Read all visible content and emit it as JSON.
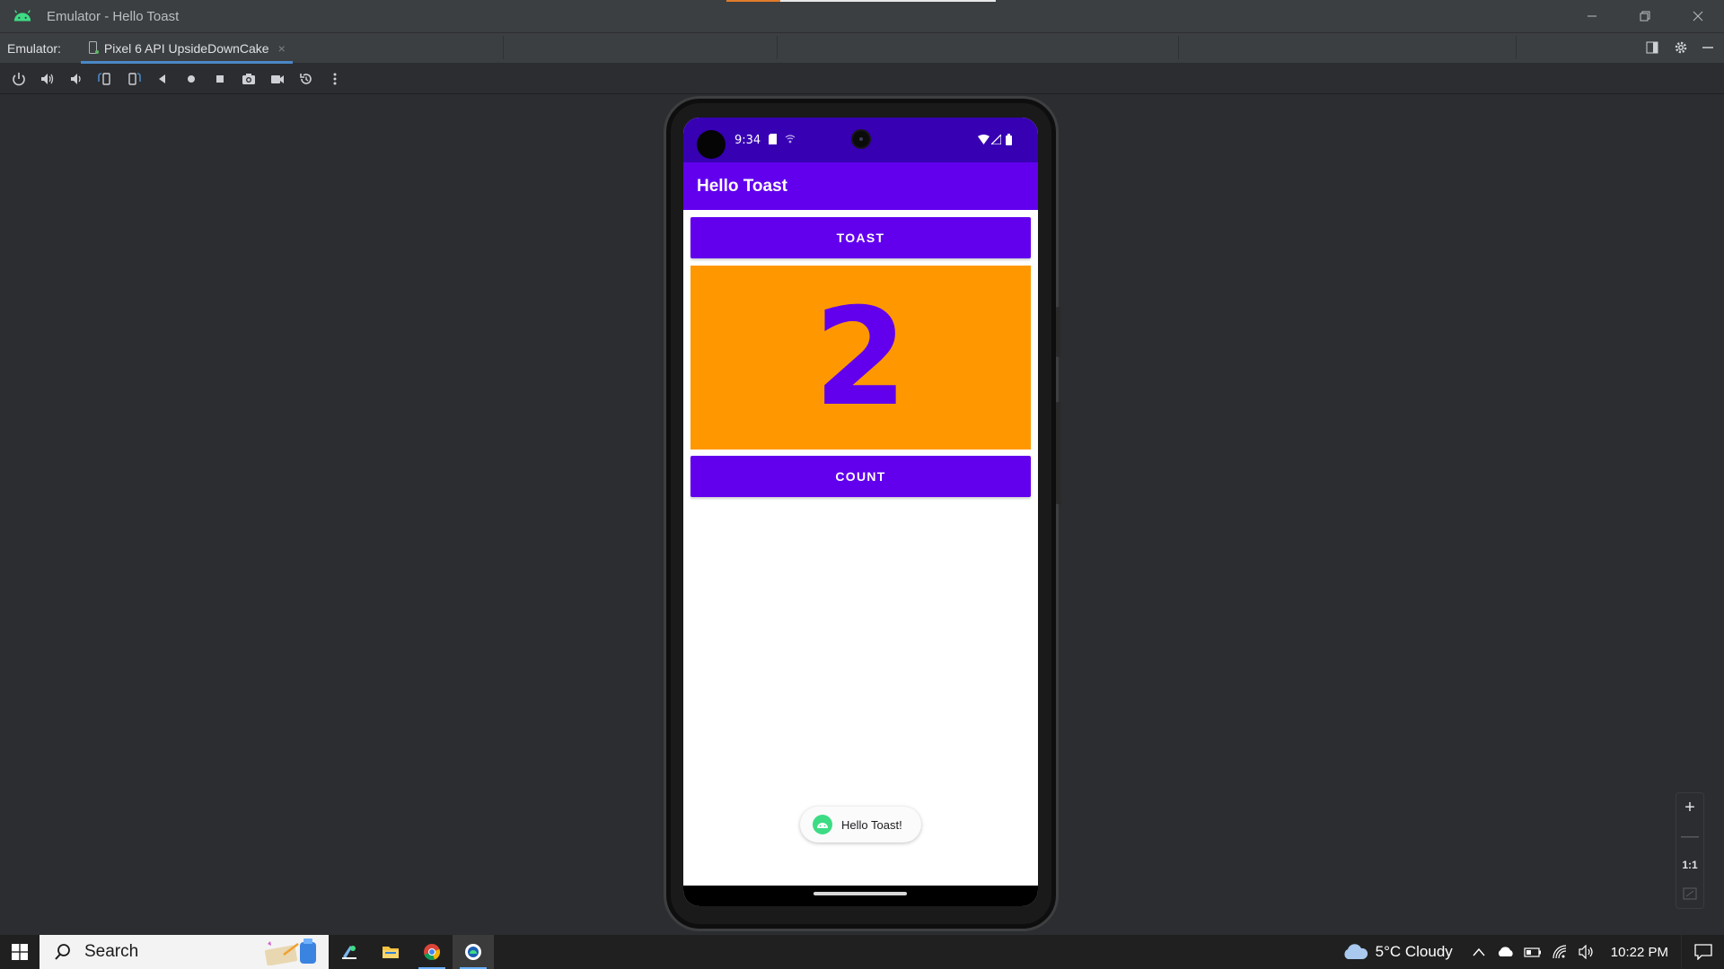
{
  "window": {
    "title": "Emulator - Hello Toast",
    "controls": [
      "minimize-icon",
      "restore-icon",
      "close-icon"
    ]
  },
  "tool_window": {
    "label": "Emulator:",
    "tab": {
      "title": "Pixel 6 API UpsideDownCake",
      "close": "×"
    },
    "right_icons": [
      "dock-icon",
      "gear-icon",
      "hide-icon"
    ]
  },
  "toolbar": {
    "icons": [
      "power-icon",
      "volume-up-icon",
      "volume-down-icon",
      "rotate-left-icon",
      "rotate-right-icon",
      "back-icon",
      "home-icon",
      "overview-icon",
      "camera-icon",
      "video-record-icon",
      "snapshot-icon",
      "more-icon"
    ]
  },
  "device": {
    "status_bar": {
      "time": "9:34"
    },
    "app_bar": {
      "title": "Hello Toast"
    },
    "toast_button": {
      "label": "TOAST"
    },
    "count_display": {
      "value": "2"
    },
    "count_button": {
      "label": "COUNT"
    },
    "toast_popup": {
      "text": "Hello Toast!"
    },
    "colors": {
      "primary": "#6200ee",
      "primary_dark": "#3700b3",
      "count_background": "#ff9800"
    }
  },
  "zoom_controls": {
    "zoom_in": "+",
    "zoom_out": "—",
    "actual_size": "1:1"
  },
  "taskbar": {
    "search": {
      "placeholder": "Search"
    },
    "weather": {
      "text": "5°C  Cloudy"
    },
    "clock": "10:22 PM"
  }
}
